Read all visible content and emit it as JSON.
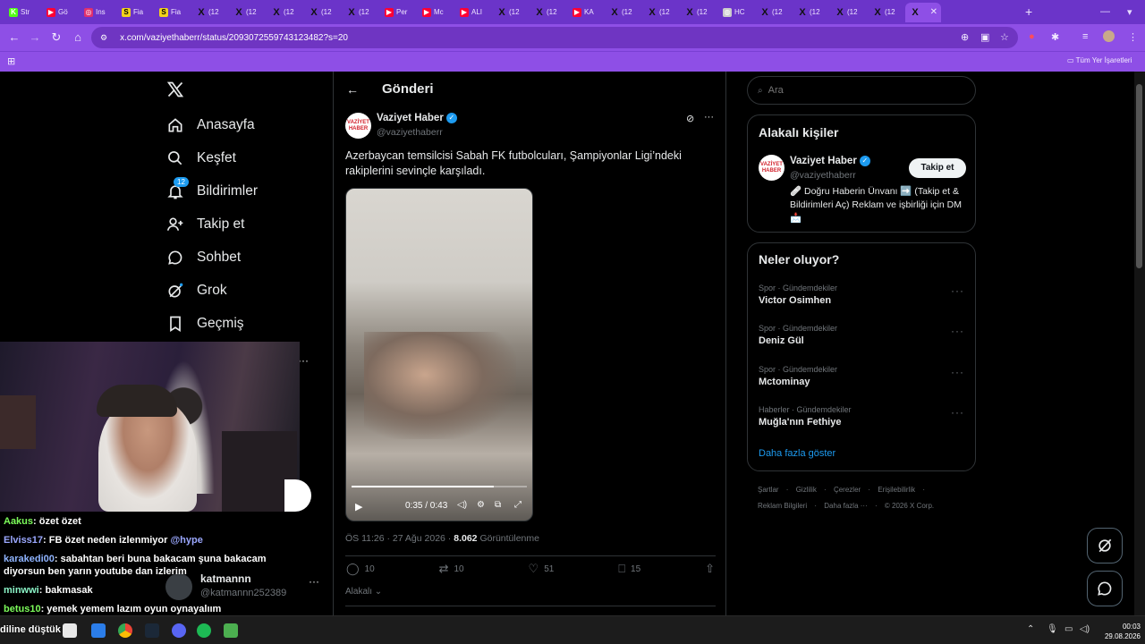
{
  "browser": {
    "tabs": [
      {
        "label": "Str",
        "icon": "kick-icon",
        "color": "#53fc18"
      },
      {
        "label": "Gö",
        "icon": "youtube-icon",
        "color": "#ff0033"
      },
      {
        "label": "Ins",
        "icon": "instagram-icon",
        "color": "#e1306c"
      },
      {
        "label": "Fia",
        "icon": "s-icon",
        "color": "#f2d31b"
      },
      {
        "label": "Fia",
        "icon": "s-icon",
        "color": "#f2d31b"
      },
      {
        "label": "(12",
        "icon": "x-icon",
        "color": "#000000"
      },
      {
        "label": "(12",
        "icon": "x-icon",
        "color": "#000000"
      },
      {
        "label": "(12",
        "icon": "x-icon",
        "color": "#000000"
      },
      {
        "label": "(12",
        "icon": "x-icon",
        "color": "#000000"
      },
      {
        "label": "(12",
        "icon": "x-icon",
        "color": "#000000"
      },
      {
        "label": "Per",
        "icon": "youtube-icon",
        "color": "#ff0033"
      },
      {
        "label": "Mc",
        "icon": "youtube-icon",
        "color": "#ff0033"
      },
      {
        "label": "ALI",
        "icon": "youtube-icon",
        "color": "#ff0033"
      },
      {
        "label": "(12",
        "icon": "x-icon",
        "color": "#000000"
      },
      {
        "label": "(12",
        "icon": "x-icon",
        "color": "#000000"
      },
      {
        "label": "KA",
        "icon": "youtube-icon",
        "color": "#ff0033"
      },
      {
        "label": "(12",
        "icon": "x-icon",
        "color": "#000000"
      },
      {
        "label": "(12",
        "icon": "x-icon",
        "color": "#000000"
      },
      {
        "label": "(12",
        "icon": "x-icon",
        "color": "#000000"
      },
      {
        "label": "HC",
        "icon": "globe-icon",
        "color": "#cccccc"
      },
      {
        "label": "(12",
        "icon": "x-icon",
        "color": "#000000"
      },
      {
        "label": "(12",
        "icon": "x-icon",
        "color": "#000000"
      },
      {
        "label": "(12",
        "icon": "x-icon",
        "color": "#000000"
      },
      {
        "label": "(12",
        "icon": "x-icon",
        "color": "#000000"
      },
      {
        "label": "(12",
        "icon": "x-icon",
        "color": "#000000"
      }
    ],
    "url": "x.com/vaziyethaberr/status/2093072559743123482?s=20",
    "bookmarks_all": "Tüm Yer İşaretleri",
    "accent": "#8e4fe6"
  },
  "nav": {
    "home": "Anasayfa",
    "explore": "Keşfet",
    "notifications": "Bildirimler",
    "notifications_badge": "12",
    "follow": "Takip et",
    "chat": "Sohbet",
    "grok": "Grok",
    "history": "Geçmiş"
  },
  "post": {
    "header": "Gönderi",
    "author_name": "Vaziyet Haber",
    "author_handle": "@vaziyethaberr",
    "avatar_text": "VAZİYET HABER",
    "text": "Azerbaycan temsilcisi Sabah FK futbolcuları, Şampiyonlar Ligi’ndeki rakiplerini sevinçle karşıladı.",
    "video_time": "0:35 / 0:43",
    "video_progress": 0.81,
    "timestamp": "ÖS 11:26 · 27 Ağu 2026 · ",
    "views_count": "8.062",
    "views_label": "Görüntülenme",
    "replies": "10",
    "reposts": "10",
    "likes": "51",
    "bookmarks": "15",
    "relevance": "Alakalı"
  },
  "account_popup": {
    "name": "katmannn",
    "handle": "@katmannn252389"
  },
  "search": {
    "placeholder": "Ara"
  },
  "related": {
    "title": "Alakalı kişiler",
    "name": "Vaziyet Haber",
    "handle": "@vaziyethaberr",
    "bio": "🩹 Doğru Haberin Ünvanı ➡️ (Takip et & Bildirimleri Aç) Reklam ve işbirliği için DM 📩",
    "follow_label": "Takip et"
  },
  "trends": {
    "title": "Neler oluyor?",
    "items": [
      {
        "category": "Spor · Gündemdekiler",
        "name": "Victor Osimhen"
      },
      {
        "category": "Spor · Gündemdekiler",
        "name": "Deniz Gül"
      },
      {
        "category": "Spor · Gündemdekiler",
        "name": "Mctominay"
      },
      {
        "category": "Haberler · Gündemdekiler",
        "name": "Muğla'nın Fethiye"
      }
    ],
    "show_more": "Daha fazla göster"
  },
  "footer": {
    "links_row1": [
      "Şartlar",
      "Gizlilik",
      "Çerezler",
      "Erişilebilirlik"
    ],
    "links_row2": [
      "Reklam Bilgileri",
      "Daha fazla ···"
    ],
    "copyright": "© 2026 X Corp."
  },
  "stream_chat": [
    {
      "user": "Aakus",
      "color": "#7cfc5a",
      "msg": ": özet özet",
      "mention": ""
    },
    {
      "user": "Elviss17",
      "color": "#9ba8ff",
      "msg": ": FB özet neden izlenmiyor ",
      "mention": "@hype"
    },
    {
      "user": "karakedi00",
      "color": "#8fb4ff",
      "msg": ": sabahtan beri buna bakacam şuna bakacam diyorsun ben yarın youtube dan izlerim",
      "mention": ""
    },
    {
      "user": "minwwi",
      "color": "#8cf5c8",
      "msg": ": bakmasak",
      "mention": ""
    },
    {
      "user": "betus10",
      "color": "#7cfc5a",
      "msg": ": yemek yemem lazım oyun oynayalıım",
      "mention": ""
    }
  ],
  "stream_overlay_text": "diline düştük",
  "taskbar": {
    "time": "00:03",
    "date": "29.08.2026"
  }
}
